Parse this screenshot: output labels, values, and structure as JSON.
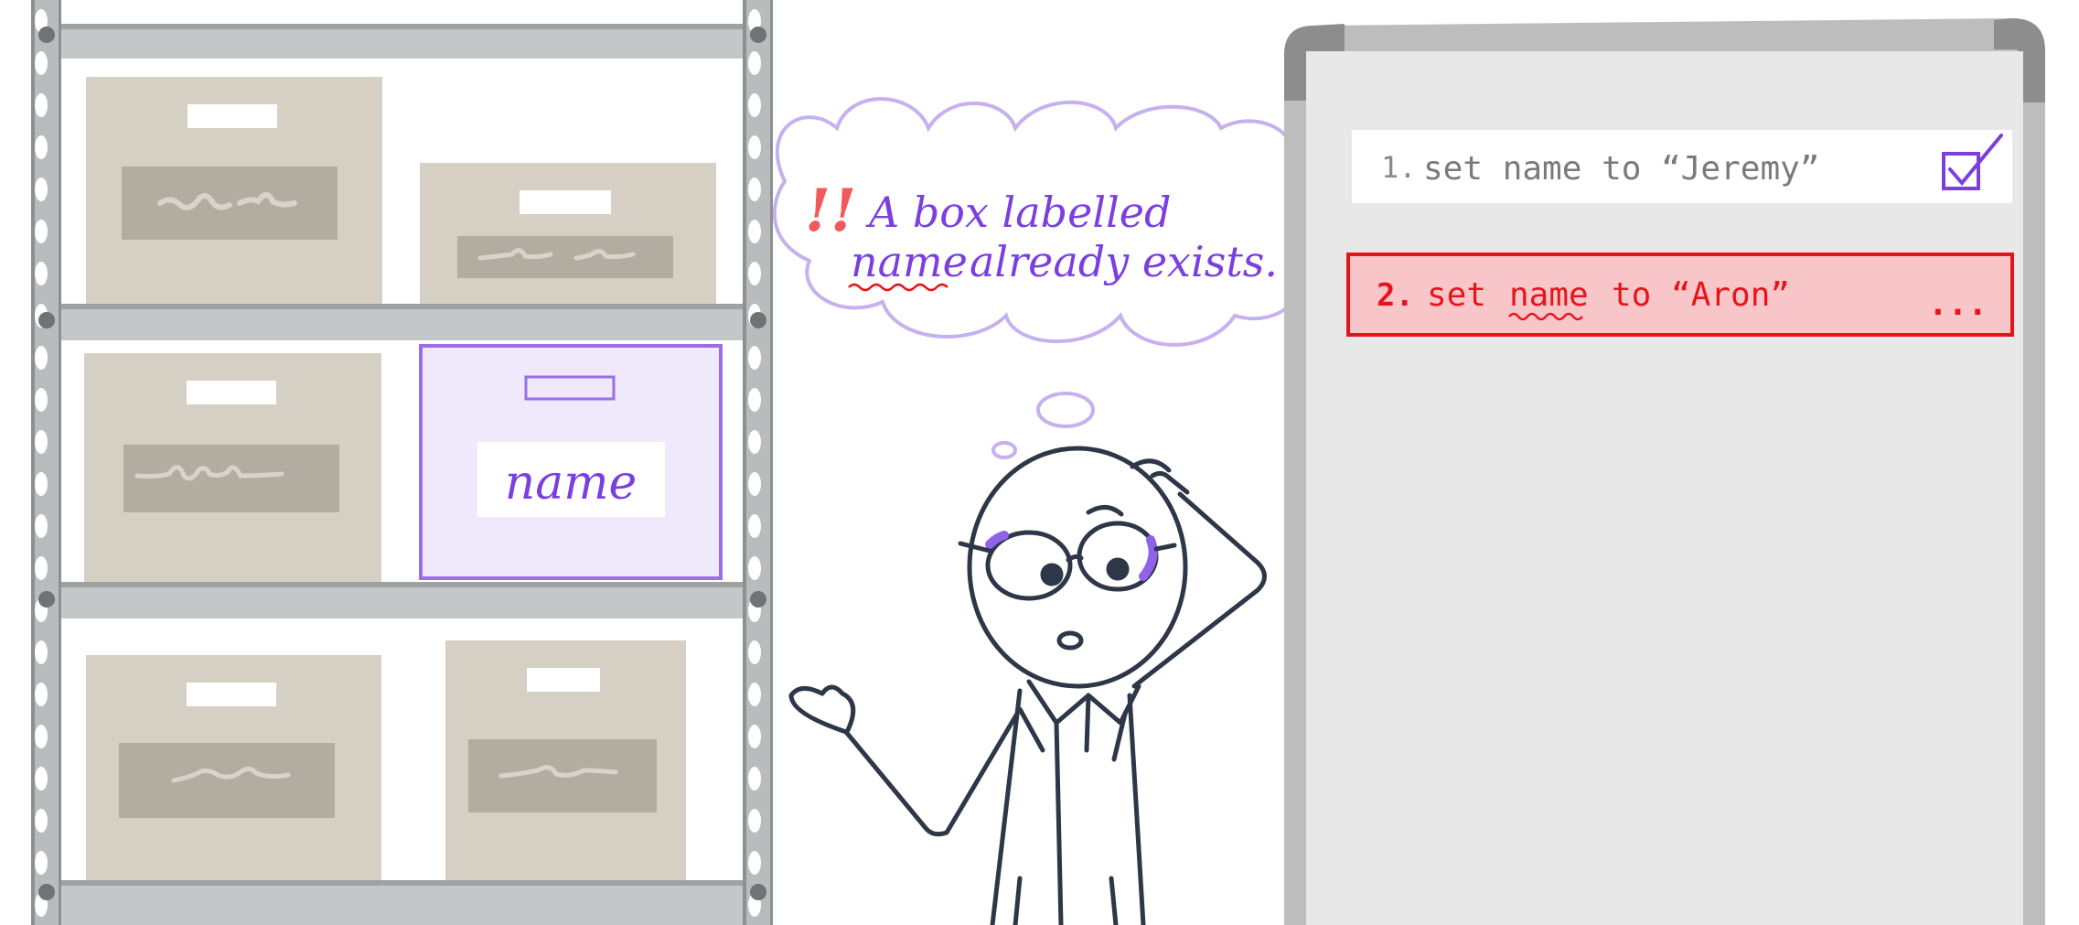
{
  "shelf": {
    "named_box_label": "name"
  },
  "thought": {
    "alert_mark": "!!",
    "line1": "A box labelled",
    "line2_keyword": "name",
    "line2_rest": "already exists."
  },
  "whiteboard": {
    "task1": {
      "number": "1.",
      "text": "set name to “Jeremy”",
      "status": "done"
    },
    "task2": {
      "number": "2.",
      "text_before": "set",
      "keyword": "name",
      "text_after": "to “Aron”",
      "pending_mark": "...",
      "status": "error"
    }
  },
  "colors": {
    "purple": "#7b3fe0",
    "purple_light": "#efe9fb",
    "error_red": "#e8141c",
    "error_fill": "#f8c6c8",
    "box_beige": "#d6d0c4",
    "box_label_gray": "#b3aca1",
    "shelf_gray": "#c4c7c7",
    "board_gray": "#e8e8e8",
    "ink": "#2d3748"
  },
  "icons": [
    "checkbox-checked-icon",
    "alert-icon",
    "thought-bubble-icon"
  ]
}
